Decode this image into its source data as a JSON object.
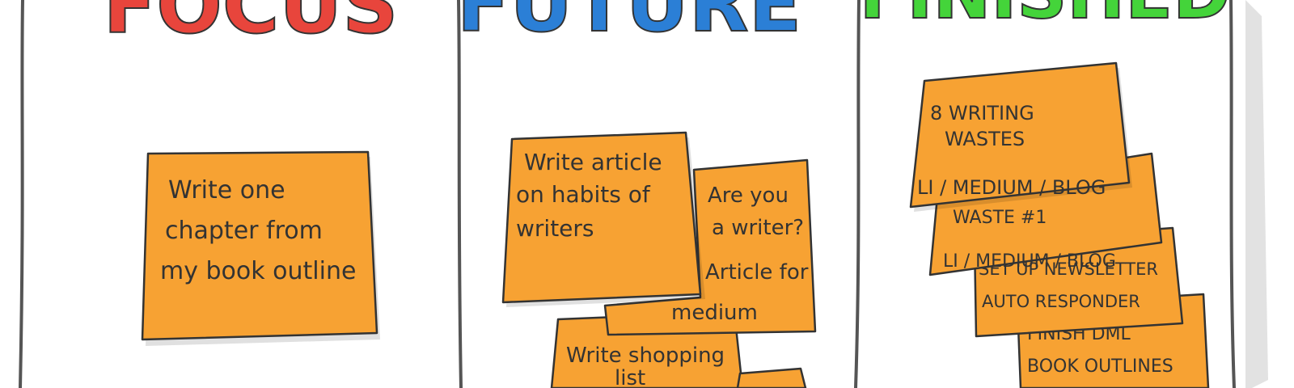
{
  "board": {
    "columns": [
      {
        "heading": "FOCUS",
        "color": "#e8453c"
      },
      {
        "heading": "FUTURE",
        "color": "#2b7fd6"
      },
      {
        "heading": "FINISHED",
        "color": "#44d43a"
      }
    ],
    "notes": {
      "focus": [
        {
          "lines": [
            "Write one",
            "chapter from",
            "my book outline"
          ]
        }
      ],
      "future": [
        {
          "lines": [
            "Write article",
            "on habits of",
            "writers"
          ]
        },
        {
          "lines": [
            "Are you",
            "a writer?",
            "Article for",
            "medium"
          ]
        },
        {
          "lines": [
            "Write shopping",
            "list"
          ]
        }
      ],
      "finished": [
        {
          "lines": [
            "8 WRITING",
            "WASTES",
            "LI / MEDIUM / BLOG"
          ]
        },
        {
          "lines": [
            "WASTE #1",
            "LI / MEDIUM / BLOG"
          ]
        },
        {
          "lines": [
            "SET UP NEWSLETTER",
            "AUTO RESPONDER"
          ]
        },
        {
          "lines": [
            "FINISH DML",
            "BOOK OUTLINES"
          ]
        }
      ]
    },
    "note_color": "#f7a233"
  }
}
